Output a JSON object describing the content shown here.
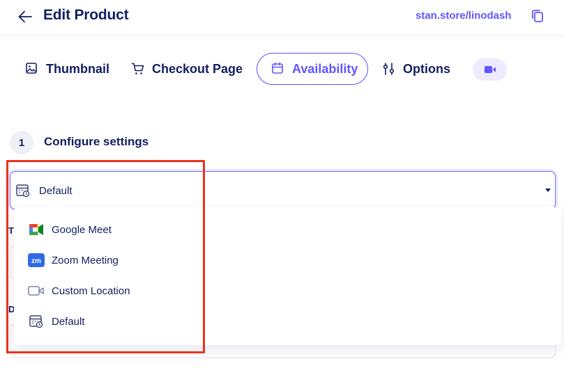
{
  "header": {
    "title": "Edit Product",
    "store_link": "stan.store/linodash",
    "back_icon": "arrow-left-icon",
    "copy_icon": "copy-icon"
  },
  "tabs": [
    {
      "label": "Thumbnail",
      "icon": "image-icon",
      "active": false
    },
    {
      "label": "Checkout Page",
      "icon": "cart-icon",
      "active": false
    },
    {
      "label": "Availability",
      "icon": "calendar-icon",
      "active": true
    },
    {
      "label": "Options",
      "icon": "sliders-icon",
      "active": false
    },
    {
      "label": "",
      "icon": "video-icon",
      "active": false
    }
  ],
  "section": {
    "step_number": "1",
    "title": "Configure settings"
  },
  "location_select": {
    "selected": "Default",
    "icon": "calendar-clock-icon",
    "options": [
      {
        "label": "Google Meet",
        "icon": "google-meet-icon"
      },
      {
        "label": "Zoom Meeting",
        "icon": "zoom-icon"
      },
      {
        "label": "Custom Location",
        "icon": "video-camera-icon"
      },
      {
        "label": "Default",
        "icon": "calendar-clock-icon"
      }
    ]
  },
  "background_labels": {
    "first": "T",
    "second": "D"
  },
  "colors": {
    "accent": "#6355ff",
    "text": "#131f60",
    "annotation": "#e8331f"
  }
}
